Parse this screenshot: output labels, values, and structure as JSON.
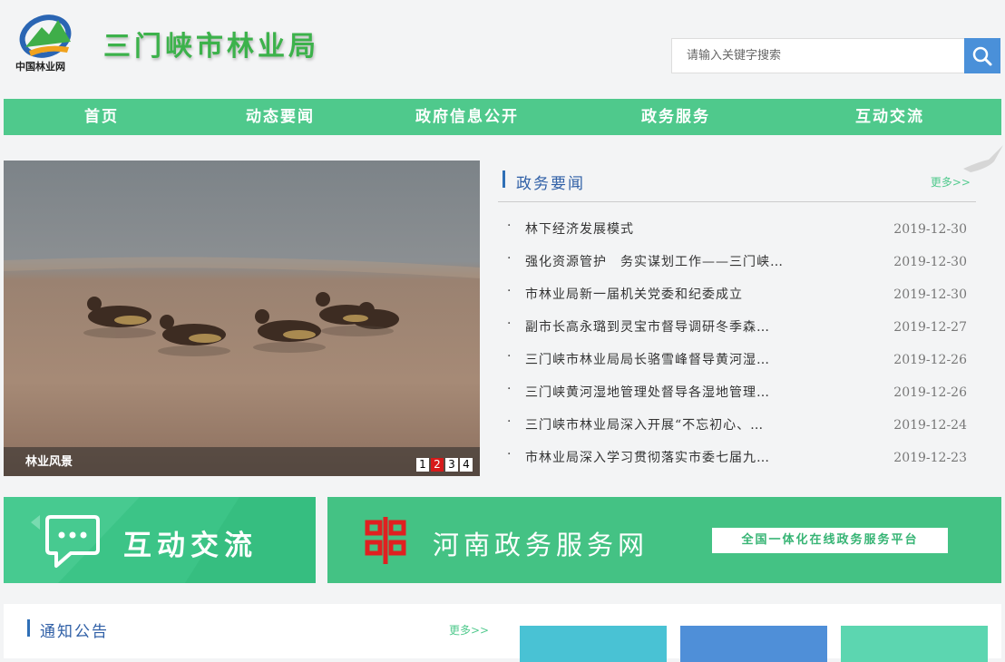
{
  "header": {
    "logo_caption": "中国林业网",
    "site_title": "三门峡市林业局",
    "search_placeholder": "请输入关键字搜索"
  },
  "nav": {
    "items": [
      {
        "label": "首页"
      },
      {
        "label": "动态要闻"
      },
      {
        "label": "政府信息公开"
      },
      {
        "label": "政务服务"
      },
      {
        "label": "互动交流"
      }
    ]
  },
  "slider": {
    "caption": "林业风景",
    "pages": [
      "1",
      "2",
      "3",
      "4"
    ],
    "active_page": 2
  },
  "news": {
    "title": "政务要闻",
    "more": "更多>>",
    "items": [
      {
        "text": "林下经济发展模式",
        "date": "2019-12-30"
      },
      {
        "text": "强化资源管护　务实谋划工作——三门峡…",
        "date": "2019-12-30"
      },
      {
        "text": "市林业局新一届机关党委和纪委成立",
        "date": "2019-12-30"
      },
      {
        "text": "副市长高永璐到灵宝市督导调研冬季森…",
        "date": "2019-12-27"
      },
      {
        "text": "三门峡市林业局局长骆雪峰督导黄河湿…",
        "date": "2019-12-26"
      },
      {
        "text": "三门峡黄河湿地管理处督导各湿地管理…",
        "date": "2019-12-26"
      },
      {
        "text": "三门峡市林业局深入开展“不忘初心、…",
        "date": "2019-12-24"
      },
      {
        "text": "市林业局深入学习贯彻落实市委七届九…",
        "date": "2019-12-23"
      }
    ]
  },
  "banners": {
    "interact_title": "互动交流",
    "service_title": "河南政务服务网",
    "service_tag": "全国一体化在线政务服务平台"
  },
  "notice": {
    "title": "通知公告",
    "more": "更多>>"
  },
  "colors": {
    "accent_green": "#4fc98c",
    "title_blue": "#2f5fa6",
    "search_blue": "#4a90d9",
    "active_dot_red": "#d71a1a"
  }
}
